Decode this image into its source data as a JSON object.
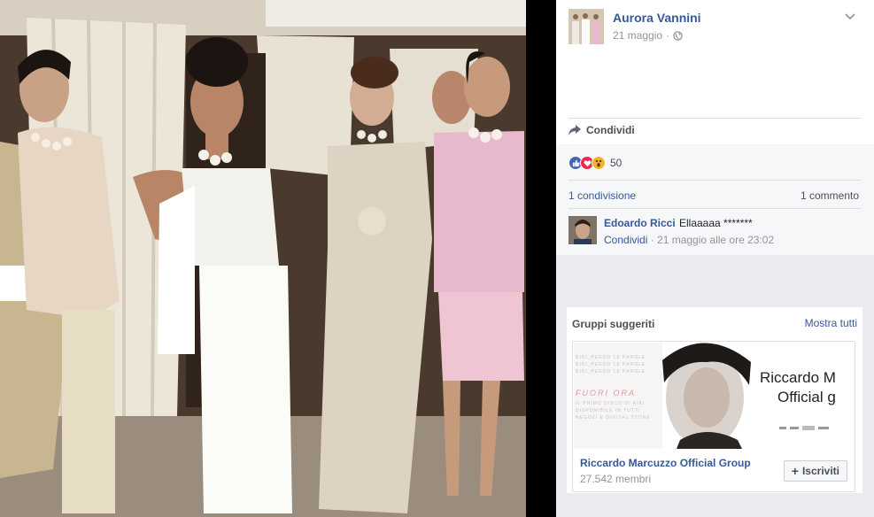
{
  "post": {
    "author": "Aurora Vannini",
    "date": "21 maggio",
    "privacy_icon": "globe-icon",
    "share_label": "Condividi",
    "reactions": [
      "like",
      "love",
      "wow"
    ],
    "reaction_count": "50",
    "shares_text": "1 condivisione",
    "comments_text": "1 commento"
  },
  "comment": {
    "author": "Edoardo Ricci",
    "text": "Ellaaaaa *******",
    "share_label": "Condividi",
    "timestamp": " · 21 maggio alle ore 23:02"
  },
  "groups": {
    "title": "Gruppi suggeriti",
    "see_all": "Mostra tutti",
    "item": {
      "banner_line1": "Riccardo M",
      "banner_line2": "Official g",
      "banner_fuori": "FUORI ORA",
      "name": "Riccardo Marcuzzo Official Group",
      "members": "27.542 membri",
      "join_label": "Iscriviti"
    }
  },
  "colors": {
    "link": "#365899",
    "muted": "#90949c",
    "like": "#4267b2",
    "love": "#f0284a",
    "wow": "#f7b125"
  }
}
